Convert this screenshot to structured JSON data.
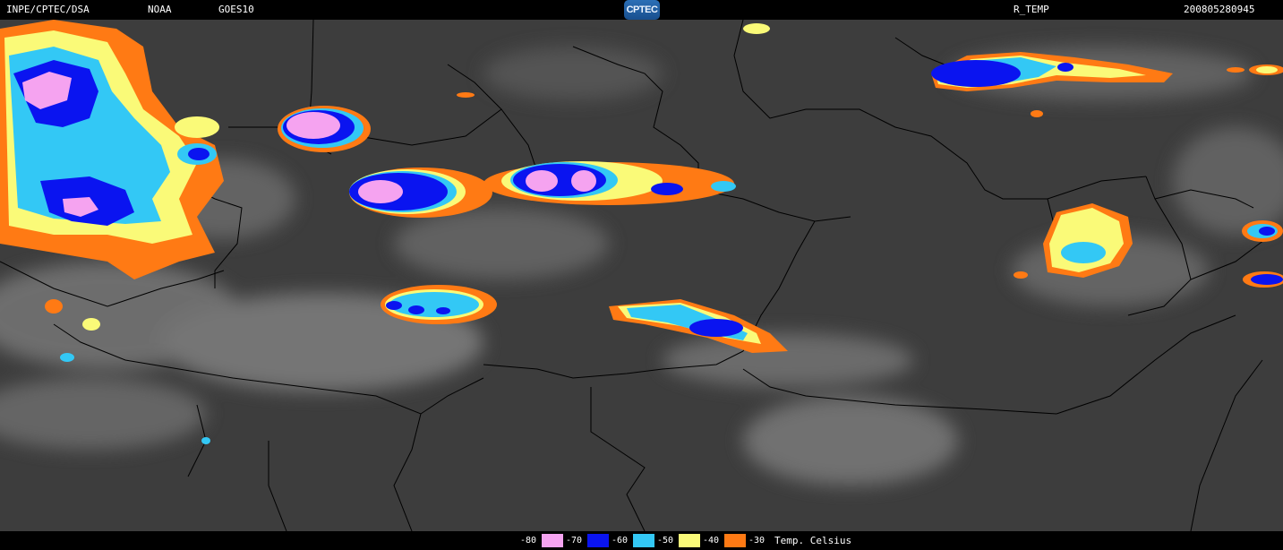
{
  "header": {
    "institution": "INPE/CPTEC/DSA",
    "agency": "NOAA",
    "satellite": "GOES10",
    "logo_text": "CPTEC",
    "product": "R_TEMP",
    "datetime": "200805280945"
  },
  "legend": {
    "items": [
      {
        "label": "-80",
        "color": "#f5a3f0"
      },
      {
        "label": "-70",
        "color": "#0a14f0"
      },
      {
        "label": "-60",
        "color": "#33c8f5"
      },
      {
        "label": "-50",
        "color": "#fafa78"
      },
      {
        "label": "-40",
        "color": "#ff7a14"
      },
      {
        "label": "-30",
        "color": "#000000"
      }
    ],
    "unit": "Temp. Celsius"
  },
  "palette": {
    "background": "#3d3d3d",
    "cloud_light": "#8a8a8a",
    "border_line": "#000000",
    "cold_orange": "#ff7a14",
    "cold_yellow": "#fafa78",
    "cold_cyan": "#33c8f5",
    "cold_blue": "#0a14f0",
    "cold_pink": "#f5a3f0"
  }
}
